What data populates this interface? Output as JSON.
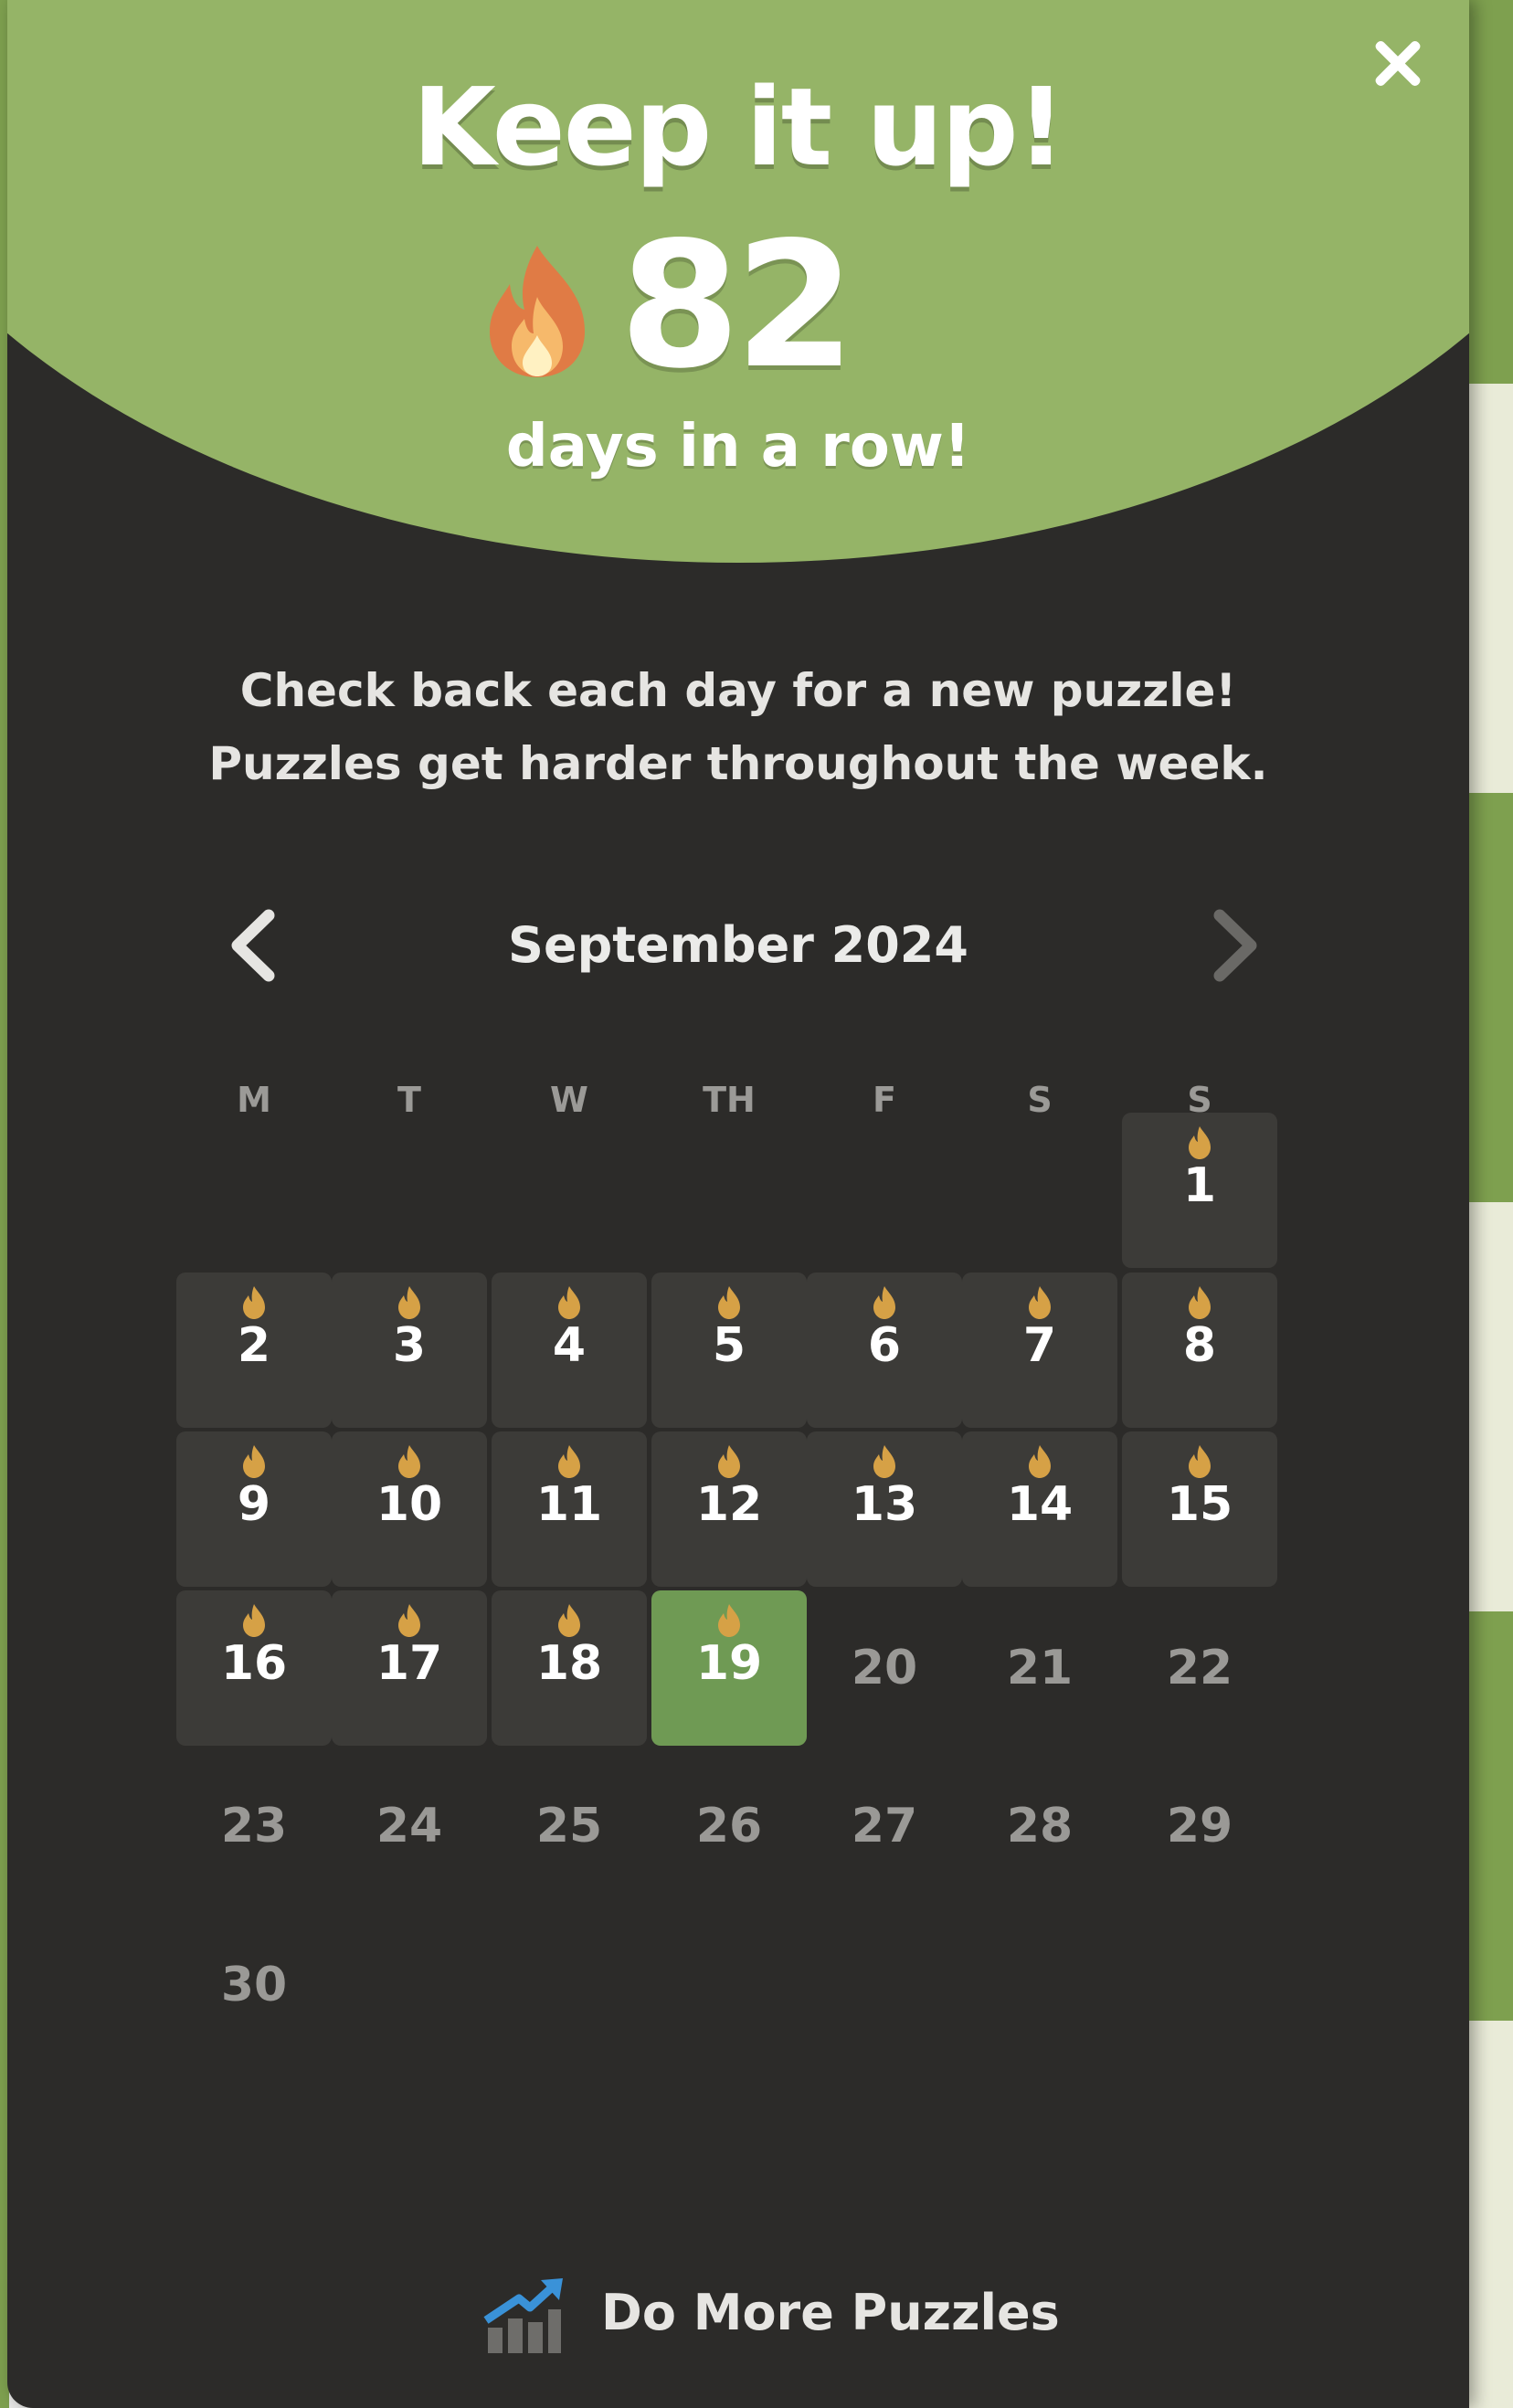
{
  "colors": {
    "hero_green": "#95b467",
    "panel_dark": "#2c2b29",
    "solved_cell": "#3c3b38",
    "today_cell": "#6f9a54",
    "flame_gold": "#d6a146",
    "future_text": "#9a9996"
  },
  "modal": {
    "close_icon": "close-icon",
    "headline": "Keep it up!",
    "streak_icon": "fire-icon",
    "streak_count": "82",
    "streak_caption": "days in a row!",
    "info_line_1": "Check back each day for a new puzzle!",
    "info_line_2": "Puzzles get harder throughout the week."
  },
  "calendar": {
    "month_label": "September 2024",
    "prev_icon": "chevron-left-icon",
    "next_icon": "chevron-right-icon",
    "weekdays": [
      "M",
      "T",
      "W",
      "TH",
      "F",
      "S",
      "S"
    ],
    "today": 19,
    "days": [
      {
        "day": "1",
        "state": "solved"
      },
      {
        "day": "2",
        "state": "solved"
      },
      {
        "day": "3",
        "state": "solved"
      },
      {
        "day": "4",
        "state": "solved"
      },
      {
        "day": "5",
        "state": "solved"
      },
      {
        "day": "6",
        "state": "solved"
      },
      {
        "day": "7",
        "state": "solved"
      },
      {
        "day": "8",
        "state": "solved"
      },
      {
        "day": "9",
        "state": "solved"
      },
      {
        "day": "10",
        "state": "solved"
      },
      {
        "day": "11",
        "state": "solved"
      },
      {
        "day": "12",
        "state": "solved"
      },
      {
        "day": "13",
        "state": "solved"
      },
      {
        "day": "14",
        "state": "solved"
      },
      {
        "day": "15",
        "state": "solved"
      },
      {
        "day": "16",
        "state": "solved"
      },
      {
        "day": "17",
        "state": "solved"
      },
      {
        "day": "18",
        "state": "solved"
      },
      {
        "day": "19",
        "state": "today"
      },
      {
        "day": "20",
        "state": "future"
      },
      {
        "day": "21",
        "state": "future"
      },
      {
        "day": "22",
        "state": "future"
      },
      {
        "day": "23",
        "state": "future"
      },
      {
        "day": "24",
        "state": "future"
      },
      {
        "day": "25",
        "state": "future"
      },
      {
        "day": "26",
        "state": "future"
      },
      {
        "day": "27",
        "state": "future"
      },
      {
        "day": "28",
        "state": "future"
      },
      {
        "day": "29",
        "state": "future"
      },
      {
        "day": "30",
        "state": "future"
      }
    ]
  },
  "footer": {
    "more_icon": "chart-arrow-icon",
    "more_label": "Do More Puzzles"
  }
}
